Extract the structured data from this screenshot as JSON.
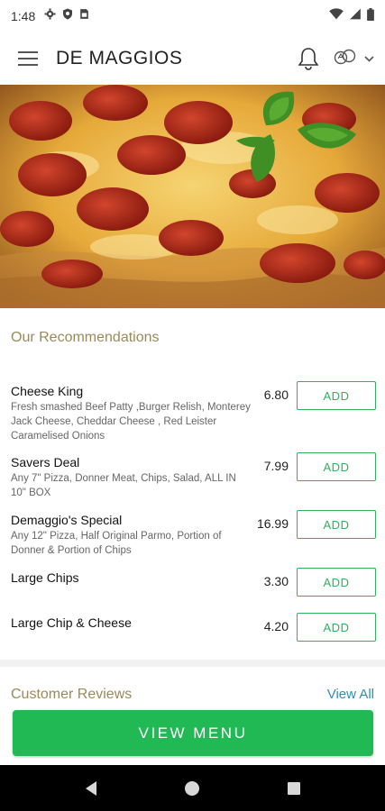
{
  "status_bar": {
    "time": "1:48",
    "left_icons": [
      "gear-icon",
      "shield-icon",
      "sim-card-icon"
    ],
    "right_icons": [
      "wifi-icon",
      "signal-icon",
      "battery-icon"
    ]
  },
  "header": {
    "title": "DE MAGGIOS",
    "icons": [
      "hamburger-menu-icon",
      "bell-icon",
      "language-icon",
      "chevron-down-icon"
    ]
  },
  "hero": {
    "image": "pepperoni pizza with basil"
  },
  "recommendations": {
    "title": "Our Recommendations",
    "add_label": "ADD",
    "items": [
      {
        "name": "Cheese King",
        "description": "Fresh smashed Beef Patty ,Burger Relish, Monterey Jack Cheese, Cheddar Cheese , Red Leister Caramelised Onions",
        "price": "6.80"
      },
      {
        "name": "Savers Deal",
        "description": "Any 7\" Pizza, Donner Meat, Chips, Salad, ALL IN 10\" BOX",
        "price": "7.99"
      },
      {
        "name": "Demaggio's Special",
        "description": "Any 12\" Pizza, Half Original Parmo, Portion of Donner & Portion of Chips",
        "price": "16.99"
      },
      {
        "name": "Large Chips",
        "description": "",
        "price": "3.30"
      },
      {
        "name": "Large Chip & Cheese",
        "description": "",
        "price": "4.20"
      }
    ]
  },
  "reviews": {
    "title": "Customer Reviews",
    "view_all_label": "View All"
  },
  "cta": {
    "view_menu_label": "VIEW MENU"
  },
  "colors": {
    "accent_green": "#20b954",
    "section_title": "#9a8a5a",
    "link_blue": "#2f8fb4"
  }
}
